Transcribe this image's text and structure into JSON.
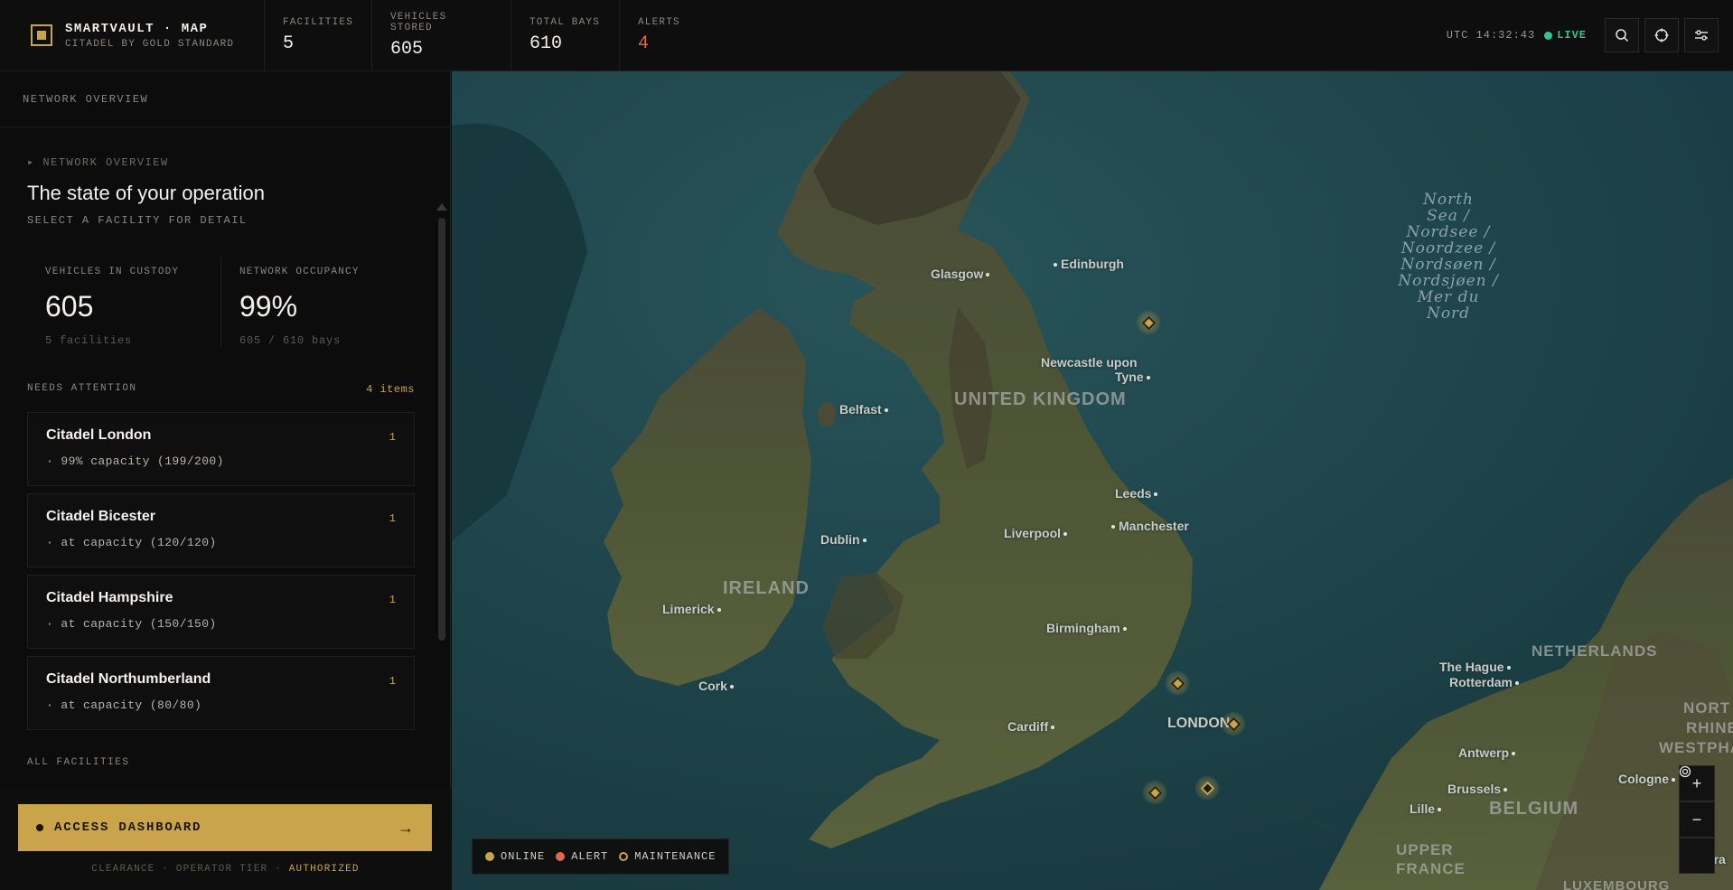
{
  "brand": {
    "title": "SMARTVAULT · MAP",
    "subtitle": "CITADEL BY GOLD STANDARD"
  },
  "stats": [
    {
      "label": "FACILITIES",
      "value": "5"
    },
    {
      "label": "VEHICLES STORED",
      "value": "605"
    },
    {
      "label": "TOTAL BAYS",
      "value": "610"
    },
    {
      "label": "ALERTS",
      "value": "4"
    }
  ],
  "topbar": {
    "utc": "UTC 14:32:43",
    "live": "LIVE",
    "icons": [
      "search-icon",
      "crosshair-icon",
      "sliders-icon"
    ]
  },
  "sidebar": {
    "header": "NETWORK OVERVIEW",
    "eyebrow": "▸ NETWORK OVERVIEW",
    "headline": "The state of your operation",
    "subhead": "SELECT A FACILITY FOR DETAIL",
    "kpis": [
      {
        "label": "VEHICLES IN CUSTODY",
        "value": "605",
        "sub": "5 facilities"
      },
      {
        "label": "NETWORK OCCUPANCY",
        "value": "99%",
        "sub": "605 / 610 bays"
      }
    ],
    "attention_label": "NEEDS ATTENTION",
    "attention_count": "4 items",
    "attention": [
      {
        "name": "Citadel London",
        "detail": "· 99% capacity (199/200)",
        "badge": "1"
      },
      {
        "name": "Citadel Bicester",
        "detail": "· at capacity (120/120)",
        "badge": "1"
      },
      {
        "name": "Citadel Hampshire",
        "detail": "· at capacity (150/150)",
        "badge": "1"
      },
      {
        "name": "Citadel Northumberland",
        "detail": "· at capacity (80/80)",
        "badge": "1"
      }
    ],
    "all_facilities_label": "ALL FACILITIES",
    "access_button": "ACCESS DASHBOARD",
    "clearance_prefix": "CLEARANCE · OPERATOR TIER ·",
    "clearance_status": "AUTHORIZED"
  },
  "map": {
    "sea_label": "North Sea / Nordsee / Noordzee / Nordsøen / Nordsjøen / Mer du Nord",
    "sea_lines": [
      "North",
      "Sea /",
      "Nordsee /",
      "Noordzee /",
      "Nordsøen /",
      "Nordsjøen /",
      "Mer du",
      "Nord"
    ],
    "countries": [
      "UNITED KINGDOM",
      "IRELAND",
      "NETHERLANDS",
      "BELGIUM",
      "UPPER",
      "FRANCE",
      "NORT",
      "RHINE",
      "WESTPHA",
      "LUXEMBOURG"
    ],
    "cities": [
      "Glasgow",
      "Edinburgh",
      "Newcastle upon",
      "Tyne",
      "Belfast",
      "Leeds",
      "Manchester",
      "Liverpool",
      "Dublin",
      "Limerick",
      "Birmingham",
      "Cork",
      "Cardiff",
      "LONDON",
      "The Hague",
      "Rotterdam",
      "Antwerp",
      "Brussels",
      "Lille",
      "Cologne",
      "Fra"
    ],
    "legend": [
      "ONLINE",
      "ALERT",
      "MAINTENANCE"
    ],
    "zoom": {
      "in": "+",
      "out": "−"
    }
  },
  "colors": {
    "accent": "#c9a44a",
    "alert": "#e2684a",
    "live": "#31c48d",
    "sea": "#1f4349",
    "land": "#4a5236"
  }
}
